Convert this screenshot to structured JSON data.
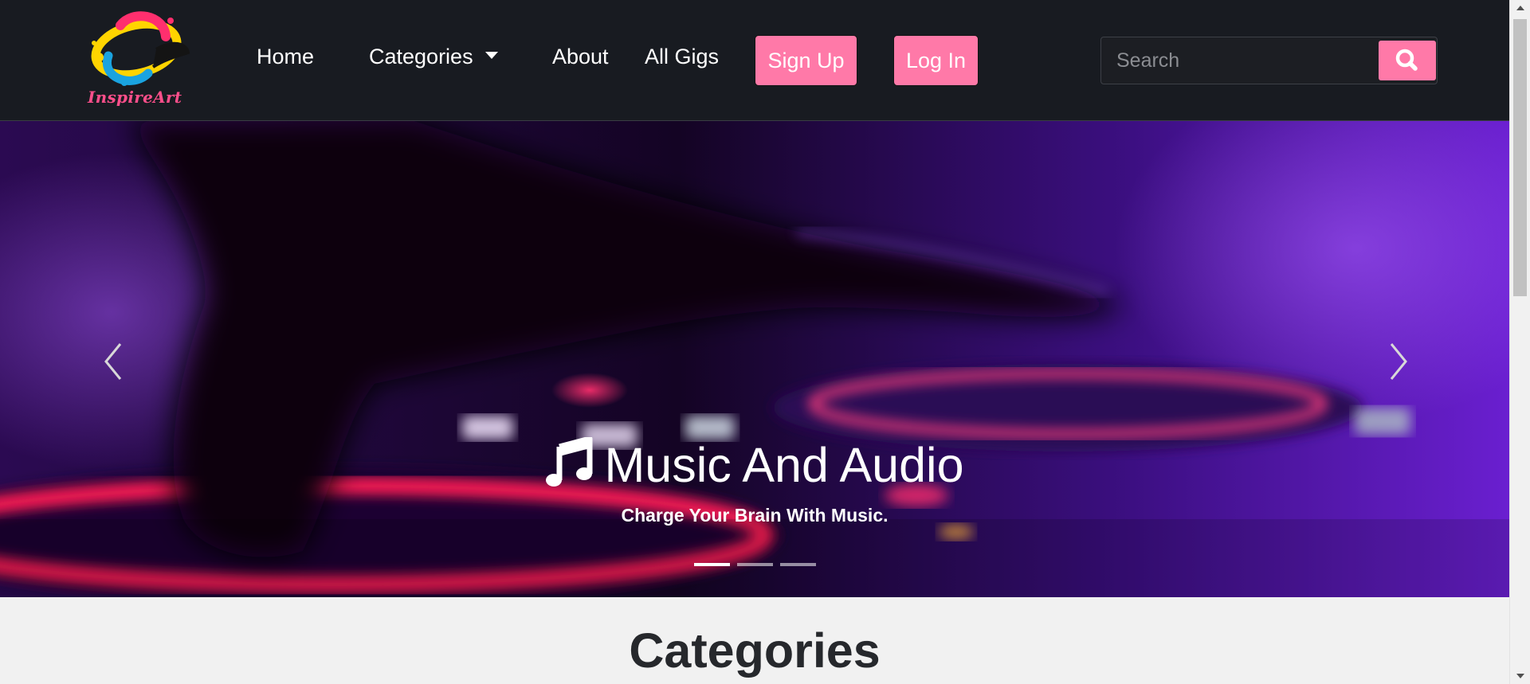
{
  "brand": {
    "logo_text": "InspireArt"
  },
  "nav": {
    "home": "Home",
    "categories": "Categories",
    "about": "About",
    "all_gigs": "All Gigs",
    "sign_up": "Sign Up",
    "log_in": "Log In"
  },
  "search": {
    "placeholder": "Search",
    "value": ""
  },
  "carousel": {
    "title": "Music And Audio",
    "subtitle": "Charge Your Brain With Music.",
    "icon": "music-note-icon",
    "slide_count": 3,
    "active_slide": 1
  },
  "section": {
    "title": "Categories"
  },
  "colors": {
    "navbar_bg": "#181b21",
    "accent_pink": "#ff79a8",
    "logo_pink": "#ff4f8b",
    "hero_purple": "#6a1fd0",
    "page_bg": "#f1f1f1",
    "heading": "#26282c"
  }
}
